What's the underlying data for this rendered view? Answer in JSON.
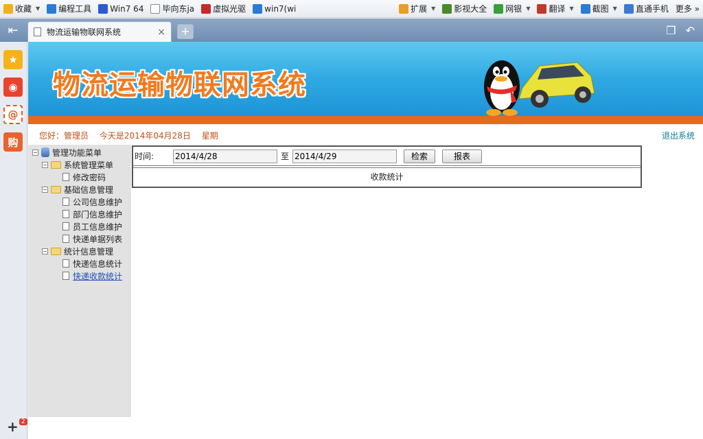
{
  "bookmarks": [
    {
      "label": "收藏",
      "icon": "star-icon",
      "color": "#f2b01e",
      "caret": true
    },
    {
      "label": "编程工具",
      "icon": "ie-icon",
      "color": "#2a7bd6",
      "caret": false
    },
    {
      "label": "Win7 64",
      "icon": "paw-icon",
      "color": "#2a5bd6",
      "caret": false
    },
    {
      "label": "毕向东ja",
      "icon": "page-icon",
      "color": "#ffffff",
      "caret": false
    },
    {
      "label": "虚拟光驱",
      "icon": "flag-icon",
      "color": "#c62a2a",
      "caret": false
    },
    {
      "label": "win7(wi",
      "icon": "globe-icon",
      "color": "#2a7bd6",
      "caret": false
    }
  ],
  "bookmarks_right": [
    {
      "label": "扩展",
      "icon": "grid-icon",
      "color": "#e8a020",
      "caret": true
    },
    {
      "label": "影视大全",
      "icon": "video-icon",
      "color": "#4a8a2a",
      "caret": false
    },
    {
      "label": "网银",
      "icon": "shield-icon",
      "color": "#3aa03a",
      "caret": true
    },
    {
      "label": "翻译",
      "icon": "translate-icon",
      "color": "#c0392b",
      "caret": true
    },
    {
      "label": "截图",
      "icon": "screenshot-icon",
      "color": "#2a7bd6",
      "caret": true
    },
    {
      "label": "直通手机",
      "icon": "phone-icon",
      "color": "#3a7ad6",
      "caret": false
    },
    {
      "label": "更多 »",
      "icon": "",
      "color": "",
      "caret": false
    }
  ],
  "tab": {
    "title": "物流运输物联网系统",
    "close": "×",
    "new_tab": "+"
  },
  "sidebar": {
    "badge": "2",
    "add": "+"
  },
  "banner": {
    "title": "物流运输物联网系统"
  },
  "greeting": {
    "hello": "您好：管理员",
    "today": "今天是2014年04月28日",
    "weekday": "星期"
  },
  "logout": "退出系统",
  "tree": [
    {
      "label": "管理功能菜单",
      "level": 0,
      "type": "root",
      "toggle": "−"
    },
    {
      "label": "系统管理菜单",
      "level": 1,
      "type": "folder",
      "toggle": "−"
    },
    {
      "label": "修改密码",
      "level": 2,
      "type": "doc"
    },
    {
      "label": "基础信息管理",
      "level": 1,
      "type": "folder",
      "toggle": "−"
    },
    {
      "label": "公司信息维护",
      "level": 2,
      "type": "doc"
    },
    {
      "label": "部门信息维护",
      "level": 2,
      "type": "doc"
    },
    {
      "label": "员工信息维护",
      "level": 2,
      "type": "doc"
    },
    {
      "label": "快递单据列表",
      "level": 2,
      "type": "doc"
    },
    {
      "label": "统计信息管理",
      "level": 1,
      "type": "folder",
      "toggle": "−"
    },
    {
      "label": "快递信息统计",
      "level": 2,
      "type": "doc"
    },
    {
      "label": "快递收款统计",
      "level": 2,
      "type": "doc",
      "link": true
    }
  ],
  "form": {
    "time_label": "时间:",
    "start_date": "2014/4/28",
    "to_label": "至",
    "end_date": "2014/4/29",
    "search_button": "检索",
    "report_button": "报表",
    "stat_title": "收款统计"
  }
}
